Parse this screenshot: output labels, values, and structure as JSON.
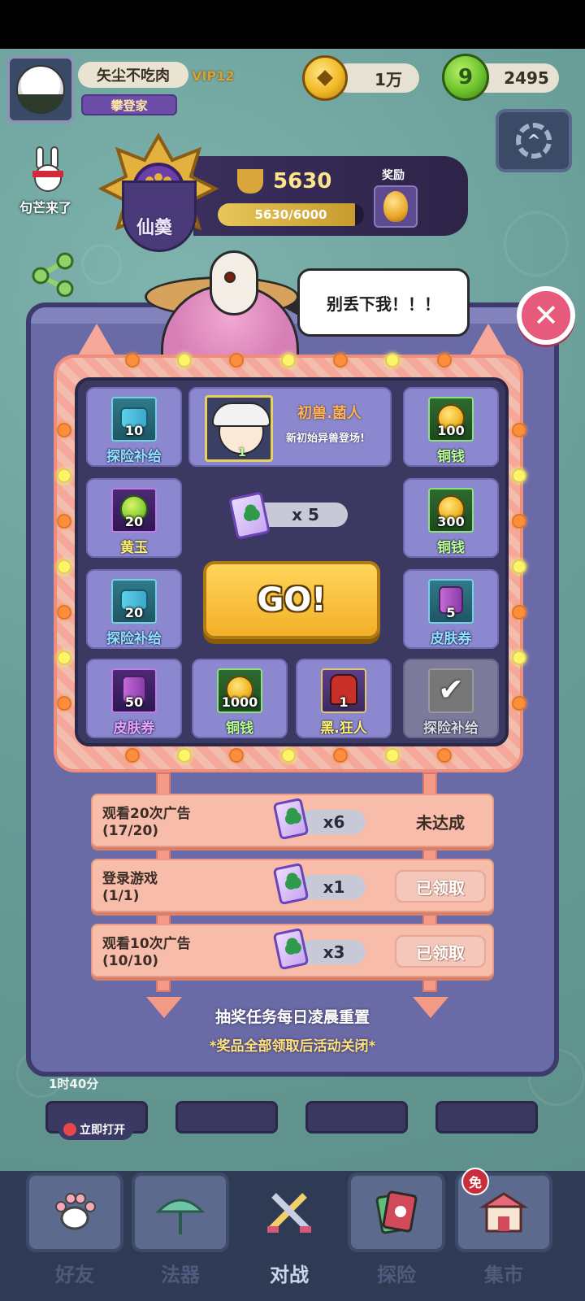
{
  "player": {
    "name": "矢尘不吃肉",
    "vip": "VIP12",
    "title": "攀登家"
  },
  "currency": {
    "coins": "1万",
    "jade": "2495",
    "jade_glyph": "9"
  },
  "sidebar": {
    "event_label": "句芒来了"
  },
  "rank": {
    "name": "仙羮",
    "trophies": "5630",
    "progress_text": "5630/6000",
    "progress_value": 0.938,
    "reward_label": "奖励"
  },
  "speech": "别丢下我！！！",
  "close_symbol": "✕",
  "board": {
    "featured": {
      "name": "初兽.菌人",
      "desc": "新初始异兽登场!",
      "qty": "1"
    },
    "tickets": "x 5",
    "go_label": "GO!",
    "cells": [
      {
        "label": "探险补给",
        "qty": "10",
        "icon": "supply-scroll-icon"
      },
      {
        "label": "铜钱",
        "qty": "100",
        "icon": "copper-coin-icon"
      },
      {
        "label": "黄玉",
        "qty": "20",
        "icon": "topaz-jade-icon"
      },
      {
        "label": "铜钱",
        "qty": "300",
        "icon": "copper-coin-icon"
      },
      {
        "label": "探险补给",
        "qty": "20",
        "icon": "supply-scroll-icon"
      },
      {
        "label": "皮肤券",
        "qty": "5",
        "icon": "skin-voucher-icon"
      },
      {
        "label": "皮肤券",
        "qty": "50",
        "icon": "skin-voucher-icon"
      },
      {
        "label": "铜钱",
        "qty": "1000",
        "icon": "copper-coin-icon"
      },
      {
        "label": "黑.狂人",
        "qty": "1",
        "icon": "beast-card-icon"
      },
      {
        "label": "探险补给",
        "qty": "",
        "icon": "checkmark-icon"
      }
    ]
  },
  "tasks": [
    {
      "name": "观看20次广告",
      "progress": "(17/20)",
      "reward": "x6",
      "status": "未达成"
    },
    {
      "name": "登录游戏",
      "progress": "(1/1)",
      "reward": "x1",
      "status": "已领取"
    },
    {
      "name": "观看10次广告",
      "progress": "(10/10)",
      "reward": "x3",
      "status": "已领取"
    }
  ],
  "notes": {
    "reset": "抽奖任务每日凌晨重置",
    "close": "*奖品全部领取后活动关闭*"
  },
  "below": {
    "timer": "1时40分",
    "open_now": "立即打开"
  },
  "nav": {
    "items": [
      {
        "label": "好友",
        "icon": "paw-icon"
      },
      {
        "label": "法器",
        "icon": "umbrella-icon"
      },
      {
        "label": "对战",
        "icon": "crossed-swords-icon"
      },
      {
        "label": "探险",
        "icon": "card-icon"
      },
      {
        "label": "集市",
        "icon": "market-icon"
      }
    ],
    "free_badge": "免"
  },
  "colors": {
    "panel": "#6a6aa6",
    "go_button": "#f4b028",
    "close_button": "#e85a7c",
    "frame": "#f5a89a"
  }
}
